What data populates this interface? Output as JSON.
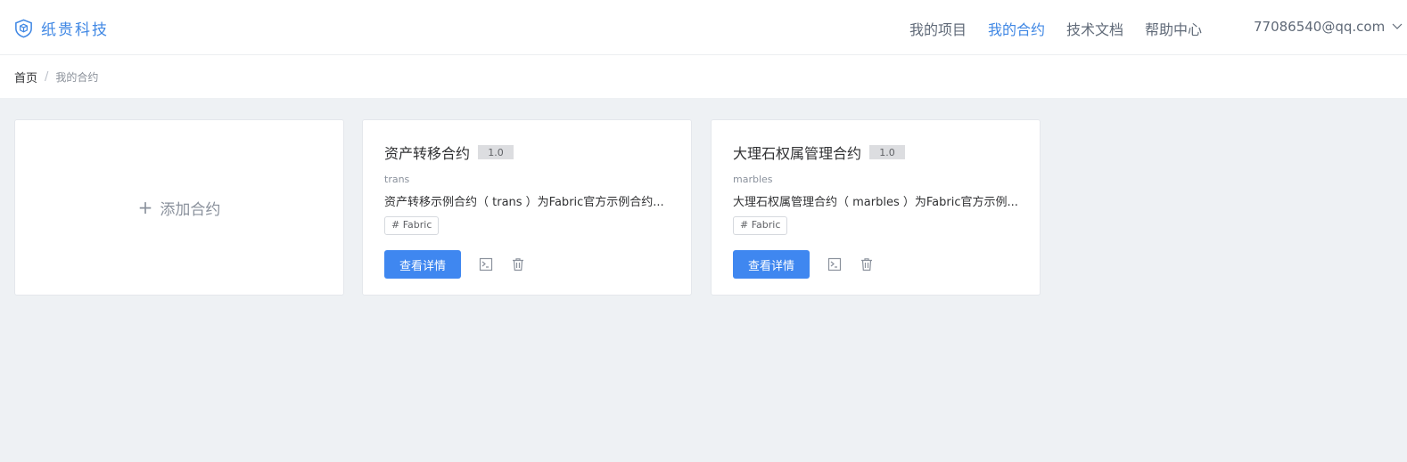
{
  "brand": {
    "name": "纸贵科技",
    "color": "#3f87e4"
  },
  "nav": {
    "items": [
      {
        "label": "我的项目"
      },
      {
        "label": "我的合约",
        "active": true
      },
      {
        "label": "技术文档"
      },
      {
        "label": "帮助中心"
      }
    ]
  },
  "user": {
    "email": "77086540@qq.com"
  },
  "breadcrumb": {
    "home": "首页",
    "separator": "/",
    "current": "我的合约"
  },
  "add_card": {
    "plus": "+",
    "label": "添加合约"
  },
  "contracts": [
    {
      "title": "资产转移合约",
      "version": "1.0",
      "slug": "trans",
      "description": "资产转移示例合约（ trans ）为Fabric官方示例合约...",
      "tag": "# Fabric",
      "detail_label": "查看详情"
    },
    {
      "title": "大理石权属管理合约",
      "version": "1.0",
      "slug": "marbles",
      "description": "大理石权属管理合约（ marbles ）为Fabric官方示例...",
      "tag": "# Fabric",
      "detail_label": "查看详情"
    }
  ],
  "icons": {
    "logo": "shield-cube-icon",
    "user_menu": "chevron-down-icon",
    "terminal": "terminal-icon",
    "delete": "trash-icon"
  },
  "colors": {
    "primary": "#3f87f0",
    "background": "#eef1f4"
  }
}
